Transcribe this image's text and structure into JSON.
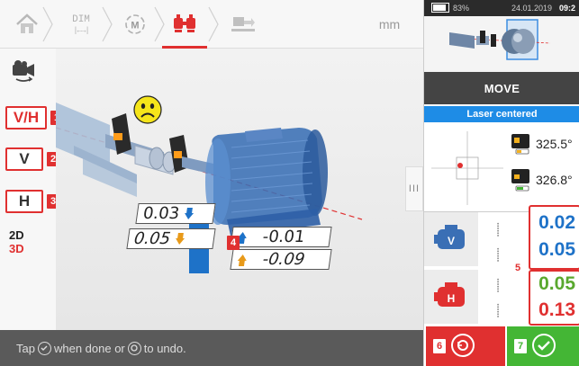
{
  "toolbar": {
    "dim_label": "DIM",
    "dim_arrow": "|←→|",
    "m_label": "M",
    "unit": "mm"
  },
  "left_tools": {
    "vh_label": "V/H",
    "v_label": "V",
    "h_label": "H",
    "mode_2d": "2D",
    "mode_3d": "3D"
  },
  "badges": [
    "1",
    "2",
    "3",
    "4",
    "5",
    "6",
    "7"
  ],
  "viewport": {
    "smiley_mood": "unhappy",
    "values": {
      "v_coupling_top_left": "0.03",
      "v_coupling_top_right": "-0.01",
      "h_coupling_bottom_left": "0.05",
      "h_coupling_bottom_right": "-0.09"
    },
    "handle": "III"
  },
  "hint": {
    "part1": "Tap",
    "part2": "when done or",
    "part3": "to undo."
  },
  "status": {
    "battery": "83%",
    "date": "24.01.2019",
    "time": "09:2"
  },
  "panel": {
    "move_label": "MOVE",
    "laser_label": "Laser centered",
    "sensor1_angle": "325.5°",
    "sensor2_angle": "326.8°",
    "result_v_top": "0.02",
    "result_v_bottom": "0.05",
    "result_h_top": "0.05",
    "result_h_bottom": "0.13",
    "coupling_symbol_a": "⸽",
    "coupling_symbol_b": "⸽"
  },
  "colors": {
    "accent_red": "#e03030",
    "ok_green": "#44b635",
    "good_value": "#59a82e",
    "blue_value": "#1e72c8",
    "laser_blue": "#1e8ce6",
    "machine_blue": "#3a6fb5"
  }
}
